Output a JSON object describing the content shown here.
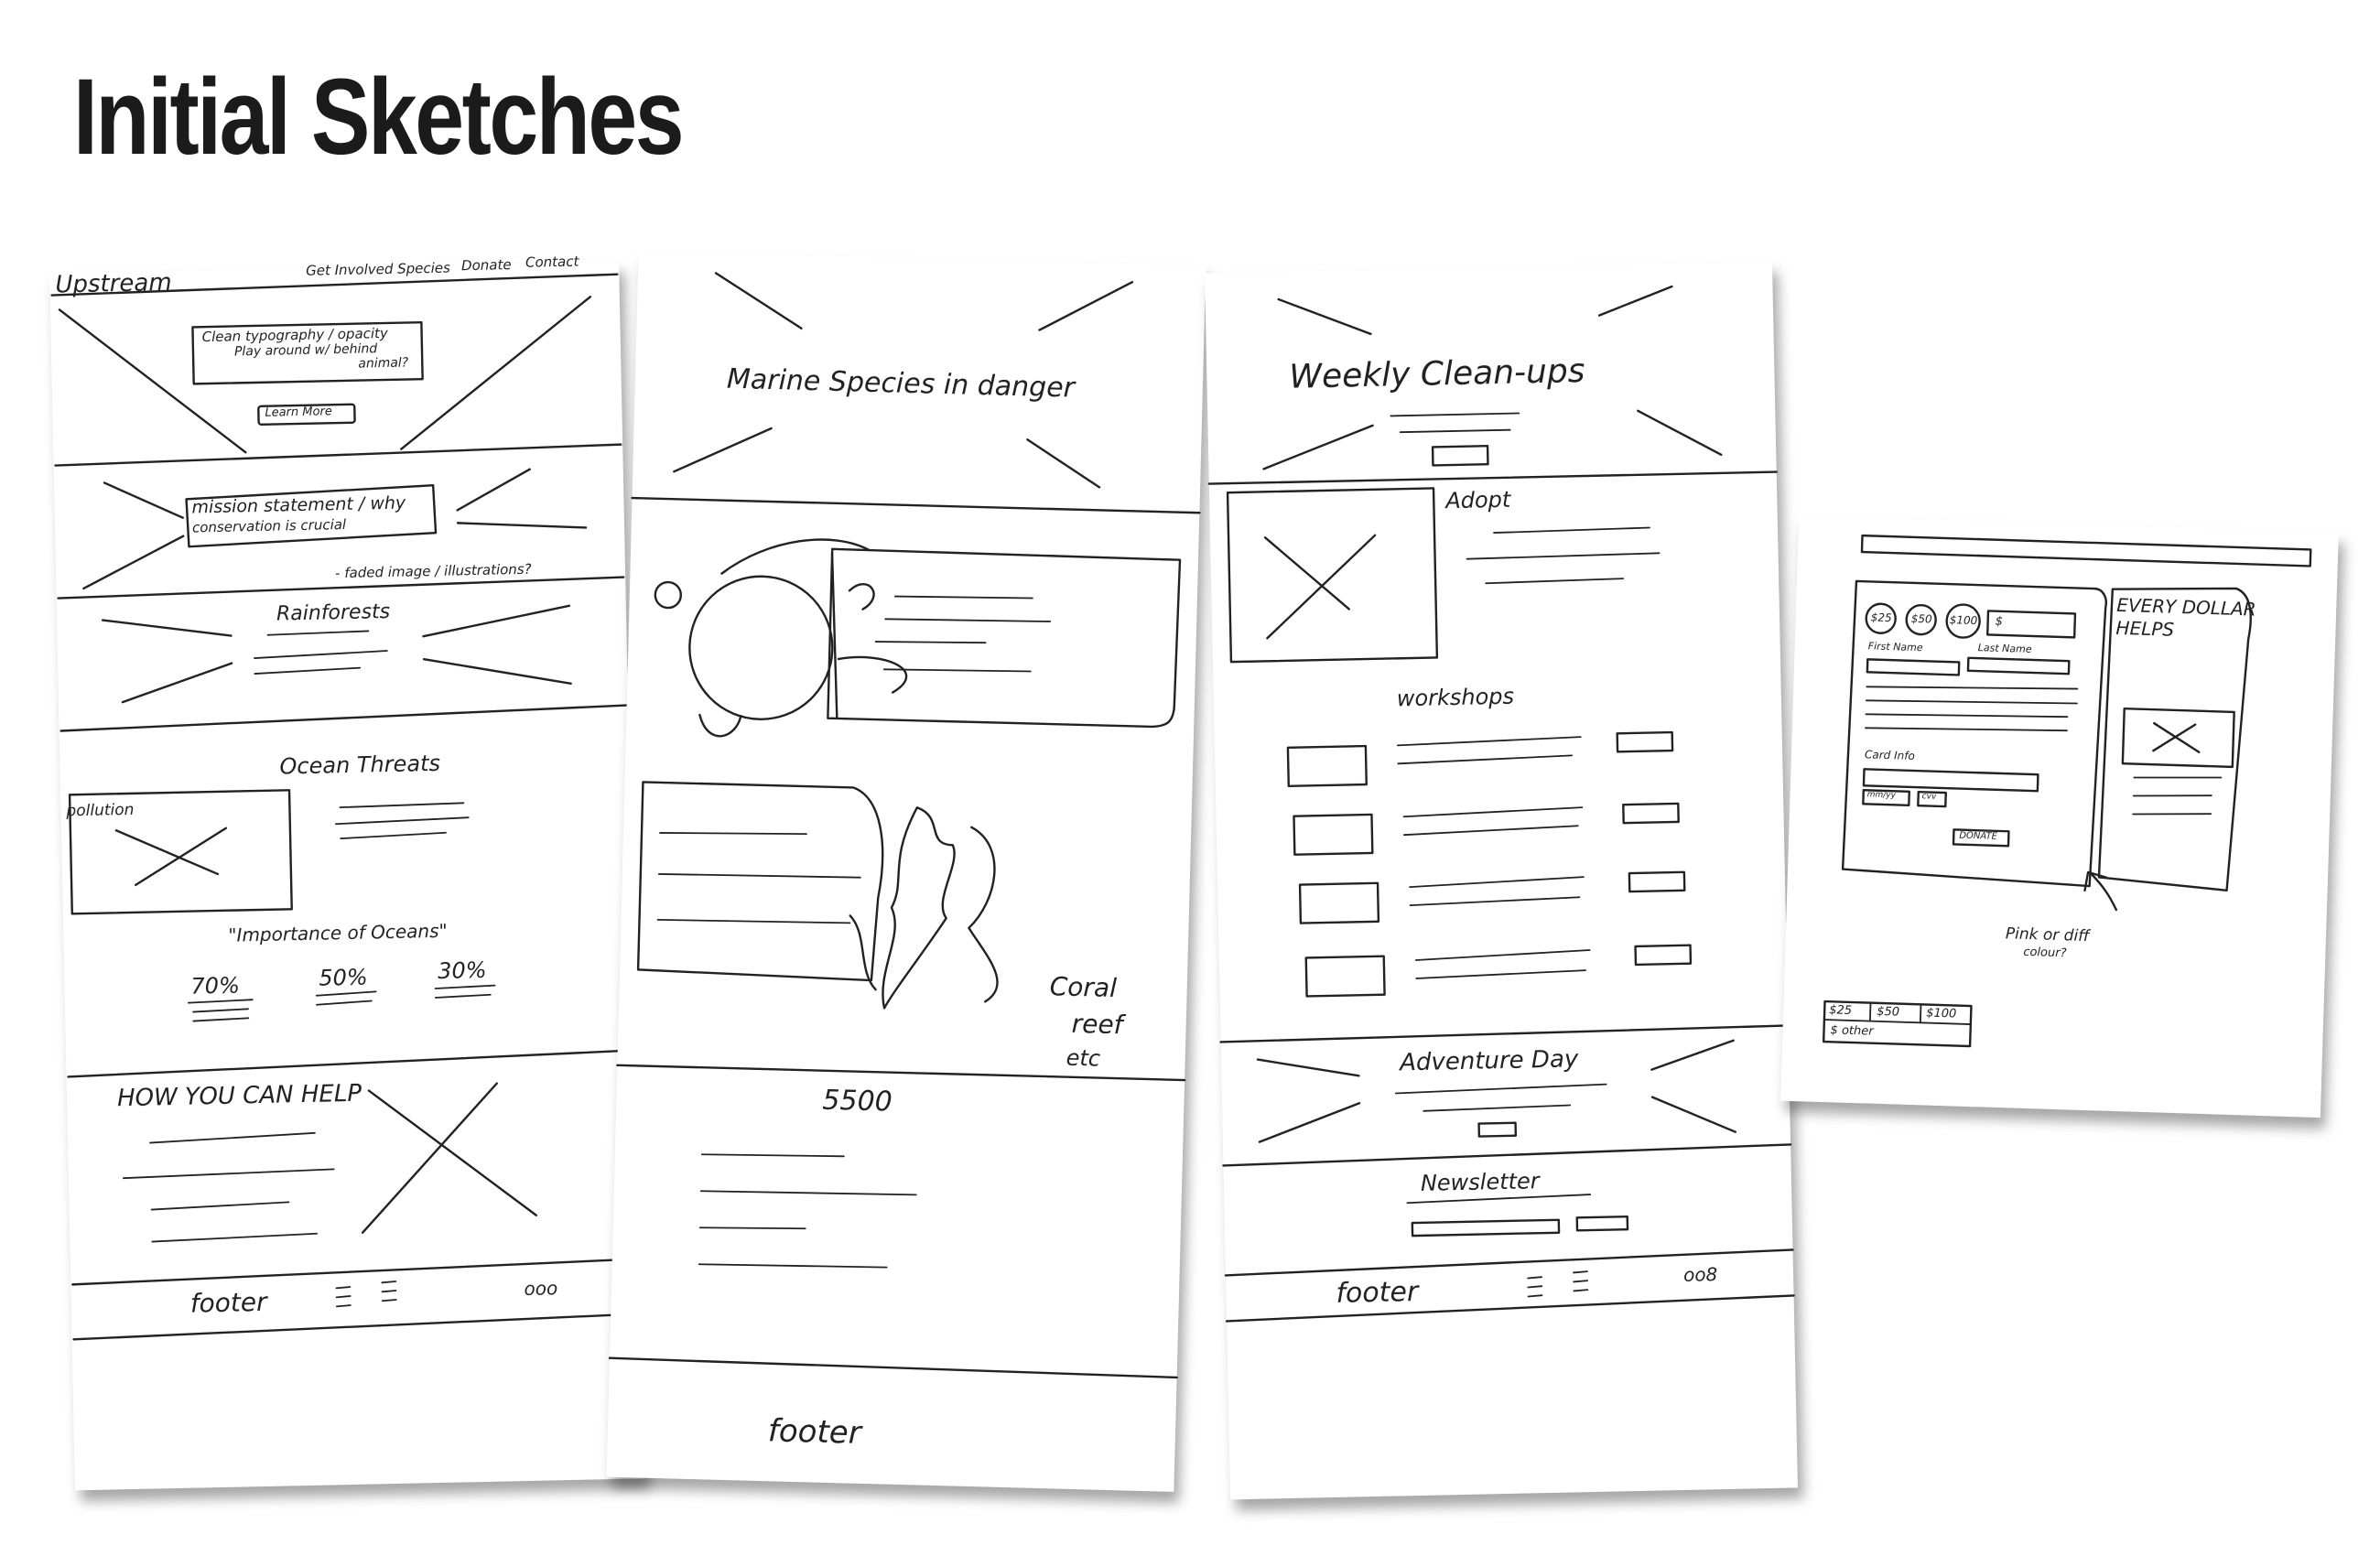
{
  "title": "Initial Sketches",
  "sheet1": {
    "logo": "Upstream",
    "nav": [
      "Get Involved",
      "Species",
      "Donate",
      "Contact"
    ],
    "hero_note_1": "Clean typography / opacity",
    "hero_note_2": "Play around w/ behind",
    "hero_note_3": "animal?",
    "hero_button": "Learn More",
    "mission_1": "mission statement / why",
    "mission_2": "conservation is crucial",
    "mission_note": "- faded image / illustrations?",
    "rainforests": "Rainforests",
    "ocean_threats": "Ocean Threats",
    "pollution": "pollution",
    "importance": "\"Importance of Oceans\"",
    "stats": [
      "70%",
      "50%",
      "30%"
    ],
    "help": "HOW YOU CAN HELP",
    "footer": "footer",
    "footer_dots": "ooo"
  },
  "sheet2": {
    "hero": "Marine Species in danger",
    "coral_1": "Coral",
    "coral_2": "reef",
    "coral_3": "etc",
    "count": "5500",
    "footer": "footer"
  },
  "sheet3": {
    "hero": "Weekly Clean-ups",
    "adopt": "Adopt",
    "workshops": "workshops",
    "adventure": "Adventure Day",
    "newsletter": "Newsletter",
    "footer": "footer",
    "footer_dots": "oo8"
  },
  "sheet4": {
    "amounts": [
      "$25",
      "$50",
      "$100",
      "$"
    ],
    "first_name": "First Name",
    "last_name": "Last Name",
    "card_info": "Card Info",
    "mmyy": "mm/yy",
    "cvv": "cvv",
    "donate": "DONATE",
    "every_dollar_1": "EVERY DOLLAR",
    "every_dollar_2": "HELPS",
    "note_1": "Pink or diff",
    "note_2": "colour?",
    "mobile_amounts": [
      "$25",
      "$50",
      "$100"
    ],
    "mobile_other": "$ other"
  }
}
